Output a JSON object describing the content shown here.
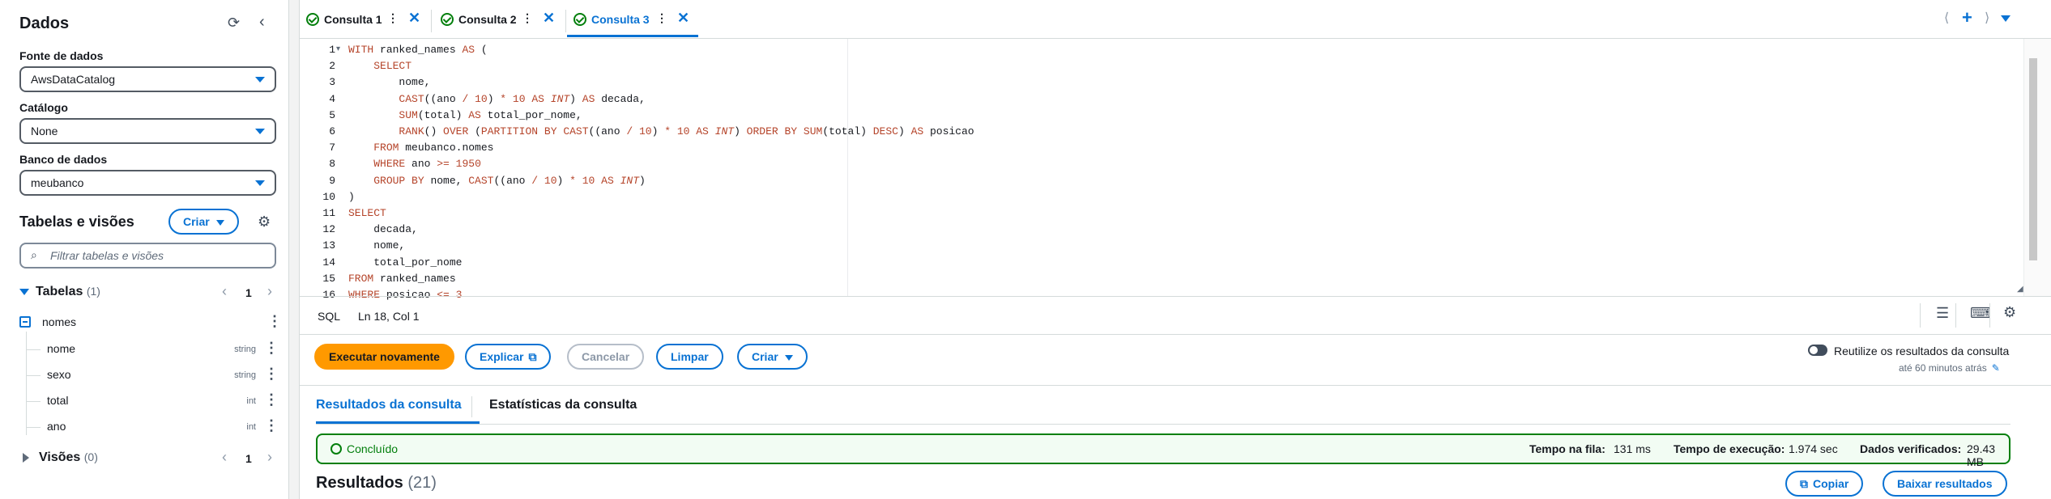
{
  "sidebar": {
    "title": "Dados",
    "source_label": "Fonte de dados",
    "source_value": "AwsDataCatalog",
    "catalog_label": "Catálogo",
    "catalog_value": "None",
    "db_label": "Banco de dados",
    "db_value": "meubanco",
    "tables_views_title": "Tabelas e visões",
    "create_label": "Criar",
    "filter_placeholder": "Filtrar tabelas e visões",
    "tables_label": "Tabelas",
    "tables_count": "(1)",
    "tables_page": "1",
    "table_name": "nomes",
    "columns": [
      {
        "name": "nome",
        "type": "string"
      },
      {
        "name": "sexo",
        "type": "string"
      },
      {
        "name": "total",
        "type": "int"
      },
      {
        "name": "ano",
        "type": "int"
      }
    ],
    "views_label": "Visões",
    "views_count": "(0)",
    "views_page": "1"
  },
  "tabs": [
    {
      "label": "Consulta 1"
    },
    {
      "label": "Consulta 2"
    },
    {
      "label": "Consulta 3"
    }
  ],
  "editor": {
    "line_numbers": [
      "1",
      "2",
      "3",
      "4",
      "5",
      "6",
      "7",
      "8",
      "9",
      "10",
      "11",
      "12",
      "13",
      "14",
      "15",
      "16"
    ],
    "status_lang": "SQL",
    "status_pos": "Ln 18, Col 1"
  },
  "actions": {
    "run_again": "Executar novamente",
    "explain": "Explicar",
    "cancel": "Cancelar",
    "clear": "Limpar",
    "create": "Criar",
    "reuse_label": "Reutilize os resultados da consulta",
    "reuse_sub": "até 60 minutos atrás"
  },
  "results_tabs": {
    "results": "Resultados da consulta",
    "stats": "Estatísticas da consulta"
  },
  "status": {
    "done": "Concluído",
    "queue_label": "Tempo na fila:",
    "queue_value": "131 ms",
    "exec_label": "Tempo de execução:",
    "exec_value": "1.974 sec",
    "scanned_label": "Dados verificados:",
    "scanned_value": "29.43 MB"
  },
  "results": {
    "title": "Resultados",
    "count": "(21)",
    "copy": "Copiar",
    "download": "Baixar resultados"
  },
  "colors": {
    "accent": "#0972d3",
    "primary": "#ff9900",
    "success": "#037f0c"
  }
}
